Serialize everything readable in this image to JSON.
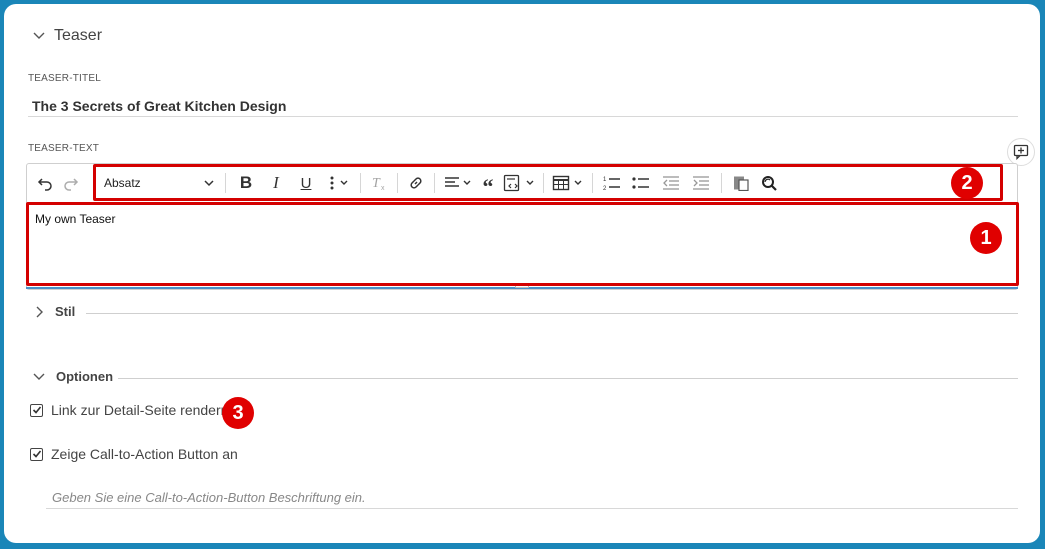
{
  "teaser_section": {
    "title": "Teaser"
  },
  "teaser_title_field": {
    "label": "TEASER-TITEL",
    "value": "The 3 Secrets of Great Kitchen Design"
  },
  "teaser_text_field": {
    "label": "TEASER-TEXT",
    "content": "My own Teaser"
  },
  "toolbar": {
    "paragraph_select": "Absatz",
    "icons": [
      "undo-icon",
      "redo-icon",
      "bold-icon",
      "italic-icon",
      "underline-icon",
      "more-vertical-icon",
      "remove-format-icon",
      "link-icon",
      "align-left-icon",
      "quote-icon",
      "source-icon",
      "table-icon",
      "numbered-list-icon",
      "bulleted-list-icon",
      "outdent-icon",
      "indent-icon",
      "paste-icon",
      "find-replace-icon"
    ]
  },
  "badges": {
    "one": "1",
    "two": "2",
    "three": "3"
  },
  "stil_section": {
    "title": "Stil"
  },
  "optionen_section": {
    "title": "Optionen",
    "link_checkbox_label": "Link zur Detail-Seite rendern",
    "cta_checkbox_label": "Zeige Call-to-Action Button an",
    "cta_placeholder": "Geben Sie eine Call-to-Action-Button Beschriftung ein."
  },
  "colors": {
    "frame_blue": "#1a86b8",
    "highlight_red": "#d40000",
    "badge_red": "#e00000"
  }
}
